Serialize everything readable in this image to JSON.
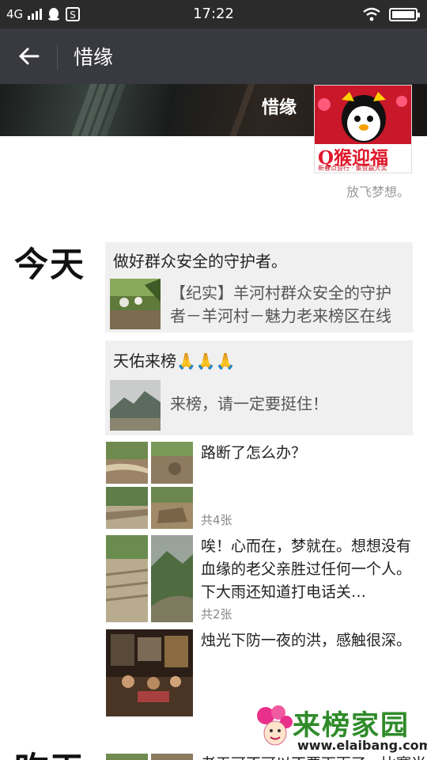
{
  "status_bar": {
    "network": "4G",
    "time": "17:22"
  },
  "title_bar": {
    "title": "惜缘"
  },
  "profile": {
    "name": "惜缘",
    "avatar_text": "Q猴迎福",
    "avatar_subtext": "新春点赞行 · 集赞赢大奖",
    "signature": "放飞梦想。"
  },
  "feed": {
    "today_label": "今天",
    "yesterday_label": "昨天",
    "posts": [
      {
        "type": "share",
        "text": "做好群众安全的守护者。",
        "link_title": "【纪实】羊河村群众安全的守护者－羊河村－魅力老来榜区在线"
      },
      {
        "type": "share",
        "text": "天佑来榜🙏🙏🙏",
        "link_title": "来榜，请一定要挺住！"
      },
      {
        "type": "photos",
        "text": "路断了怎么办？",
        "photo_count": "共4张"
      },
      {
        "type": "photos",
        "text": "唉！心而在，梦就在。想想没有血缘的老父亲胜过任何一个人。下大雨还知道打电话关…",
        "photo_count": "共2张"
      },
      {
        "type": "photos",
        "text": "烛光下防一夜的洪，感触很深。"
      }
    ],
    "yesterday_preview": "老天可不可以不要下雨了，比赛当"
  },
  "watermark": {
    "title": "来榜家园",
    "url": "www.elaibang.com"
  }
}
